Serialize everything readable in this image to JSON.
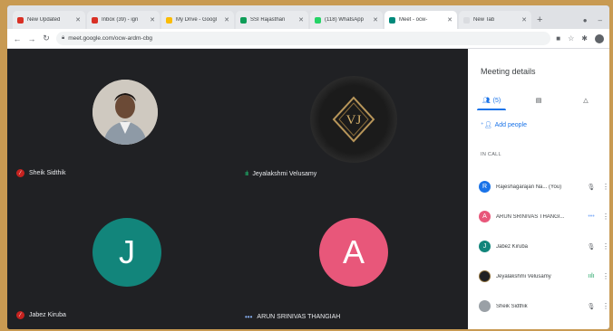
{
  "browser": {
    "tabs": [
      {
        "label": "New Updated",
        "favicon_color": "#d93025"
      },
      {
        "label": "Inbox (39) - ign",
        "favicon_color": "#d93025"
      },
      {
        "label": "My Drive - Googl",
        "favicon_color": "#fbbc04"
      },
      {
        "label": "SSI Rajasthan",
        "favicon_color": "#0f9d58"
      },
      {
        "label": "(118) WhatsApp",
        "favicon_color": "#25d366"
      },
      {
        "label": "Meet - ocw-",
        "favicon_color": "#00897b",
        "active": true
      },
      {
        "label": "New Tab",
        "favicon_color": "#dadce0"
      }
    ],
    "new_tab_symbol": "+",
    "url": "meet.google.com/ocw-ardm-cbg"
  },
  "meeting": {
    "tiles": [
      {
        "name": "Sheik Sidthik",
        "avatar_type": "photo",
        "status": "muted"
      },
      {
        "name": "Jeyalakshmi Velusamy",
        "avatar_type": "logo",
        "logo_text": "VJ",
        "status": "speaking"
      },
      {
        "name": "Jabez Kiruba",
        "avatar_type": "letter",
        "letter": "J",
        "avatar_color": "#12857b",
        "status": "muted"
      },
      {
        "name": "ARUN SRINIVAS THANGIAH",
        "avatar_type": "letter",
        "letter": "A",
        "avatar_color": "#e8577a",
        "status": "dots"
      }
    ]
  },
  "panel": {
    "title": "Meeting details",
    "people_tab_label": "(5)",
    "add_people_label": "Add people",
    "in_call_label": "IN CALL",
    "participants": [
      {
        "name": "Rajeshagarajan Na... (You)",
        "avatar_color": "#1a73e8",
        "initial": "R",
        "status": "muted"
      },
      {
        "name": "ARUN SRINIVAS THANGI...",
        "avatar_color": "#e8577a",
        "initial": "A",
        "status": "dots"
      },
      {
        "name": "Jabez Kiruba",
        "avatar_color": "#12857b",
        "initial": "J",
        "status": "muted"
      },
      {
        "name": "Jeyalakshmi Velusamy",
        "avatar_color": "#202124",
        "initial": "",
        "status": "speaking"
      },
      {
        "name": "Sheik Sidthik",
        "avatar_color": "#9aa0a6",
        "initial": "",
        "status": "muted"
      }
    ]
  },
  "colors": {
    "muted_indicator": "#c5221f",
    "speaking_indicator": "#1ea362",
    "accent": "#1a73e8"
  }
}
